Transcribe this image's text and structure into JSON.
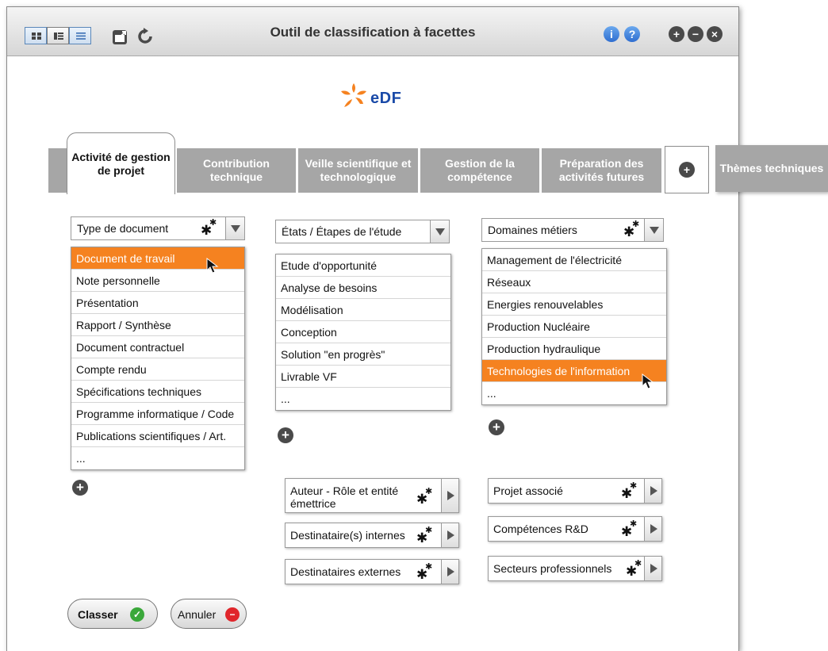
{
  "window": {
    "title": "Outil de classification à facettes",
    "view_modes": [
      "grid-view-icon",
      "details-view-icon",
      "list-view-icon"
    ],
    "tools": [
      "external-window-icon",
      "refresh-icon"
    ],
    "help_buttons": [
      {
        "icon": "info-icon",
        "glyph": "i"
      },
      {
        "icon": "help-icon",
        "glyph": "?"
      }
    ],
    "window_controls": [
      {
        "icon": "plus-icon",
        "glyph": "+"
      },
      {
        "icon": "minus-icon",
        "glyph": "−"
      },
      {
        "icon": "close-icon",
        "glyph": "×"
      }
    ]
  },
  "logo": {
    "text": "eDF",
    "brand_blue": "#1a4aa8",
    "brand_orange": "#f58220"
  },
  "tabs": [
    {
      "label": "Activité de gestion de projet",
      "active": true
    },
    {
      "label": "Contribution technique"
    },
    {
      "label": "Veille scientifique et technologique"
    },
    {
      "label": "Gestion de la compétence"
    },
    {
      "label": "Préparation des activités futures"
    },
    {
      "label": "Thèmes techniques"
    }
  ],
  "add_tab_glyph": "+",
  "columns": [
    {
      "dropdown": "Type de document",
      "has_gear": true,
      "items": [
        "Document de travail",
        "Note personnelle",
        "Présentation",
        "Rapport / Synthèse",
        "Document contractuel",
        "Compte rendu",
        "Spécifications techniques",
        "Programme informatique / Code",
        "Publications scientifiques / Art.",
        "..."
      ],
      "selected": "Document de travail"
    },
    {
      "dropdown": "États / Étapes de l'étude",
      "has_gear": false,
      "items": [
        "Etude d'opportunité",
        "Analyse de besoins",
        "Modélisation",
        "Conception",
        "Solution \"en progrès\"",
        "Livrable VF",
        "..."
      ],
      "selected": null
    },
    {
      "dropdown": "Domaines métiers",
      "has_gear": true,
      "items": [
        "Management de l'électricité",
        "Réseaux",
        "Energies renouvelables",
        "Production Nucléaire",
        "Production hydraulique",
        "Technologies de l'information",
        "..."
      ],
      "selected": "Technologies de l'information"
    }
  ],
  "add_glyph": "+",
  "facets_left": [
    "Auteur - Rôle et entité émettrice",
    "Destinataire(s) internes",
    "Destinataires externes"
  ],
  "facets_right": [
    "Projet associé",
    "Compétences R&D",
    "Secteurs professionnels"
  ],
  "actions": {
    "classify": {
      "label": "Classer",
      "icon": "check-icon",
      "glyph": "✓",
      "color": "#3aa83a"
    },
    "cancel": {
      "label": "Annuler",
      "icon": "no-entry-icon",
      "glyph": "−",
      "color": "#e0262b"
    }
  },
  "colors": {
    "tab_grey": "#a6a6a6",
    "selection_orange": "#f58220",
    "dark_icon": "#4a4a4a"
  }
}
